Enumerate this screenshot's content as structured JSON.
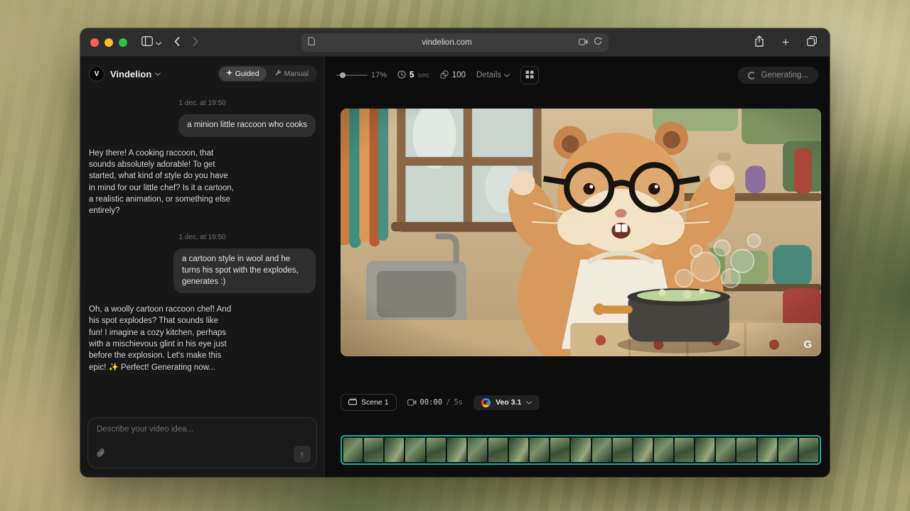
{
  "browser": {
    "url": "vindelion.com"
  },
  "chat": {
    "brand": "Vindelion",
    "avatar_letter": "V",
    "modes": {
      "guided": "Guided",
      "manual": "Manual"
    },
    "groups": [
      {
        "timestamp": "1 dec. at 19:50",
        "user": "a minion little raccoon who cooks",
        "assistant": "Hey there! A cooking raccoon, that sounds absolutely adorable! To get started, what kind of style do you have in mind for our little chef? Is it a cartoon, a realistic animation, or something else entirely?"
      },
      {
        "timestamp": "1 dec. at 19:50",
        "user": "a cartoon style in wool and he turns his spot with the explodes, generates :)",
        "assistant": "Oh, a woolly cartoon raccoon chef! And his spot explodes? That sounds like fun! I imagine a cozy kitchen, perhaps with a mischievous glint in his eye just before the explosion. Let's make this epic! ✨ Perfect! Generating now..."
      }
    ],
    "composer": {
      "placeholder": "Describe your video idea..."
    }
  },
  "toolbar": {
    "zoom": "17%",
    "duration_value": "5",
    "duration_unit": "sec",
    "credits": "100",
    "details_label": "Details",
    "generating_label": "Generating..."
  },
  "scene_bar": {
    "scene_label": "Scene 1",
    "time_current": "00:00",
    "time_separator": "/",
    "time_total": "5s",
    "model_label": "Veo 3.1"
  },
  "preview": {
    "watermark": "G"
  },
  "icons": {
    "plus": "+",
    "send_arrow": "↑"
  },
  "colors": {
    "timeline_accent": "#2aa18f",
    "window_chrome": "#2d2d2d",
    "panel_bg": "#171717",
    "stage_bg": "#0d0d0d"
  }
}
